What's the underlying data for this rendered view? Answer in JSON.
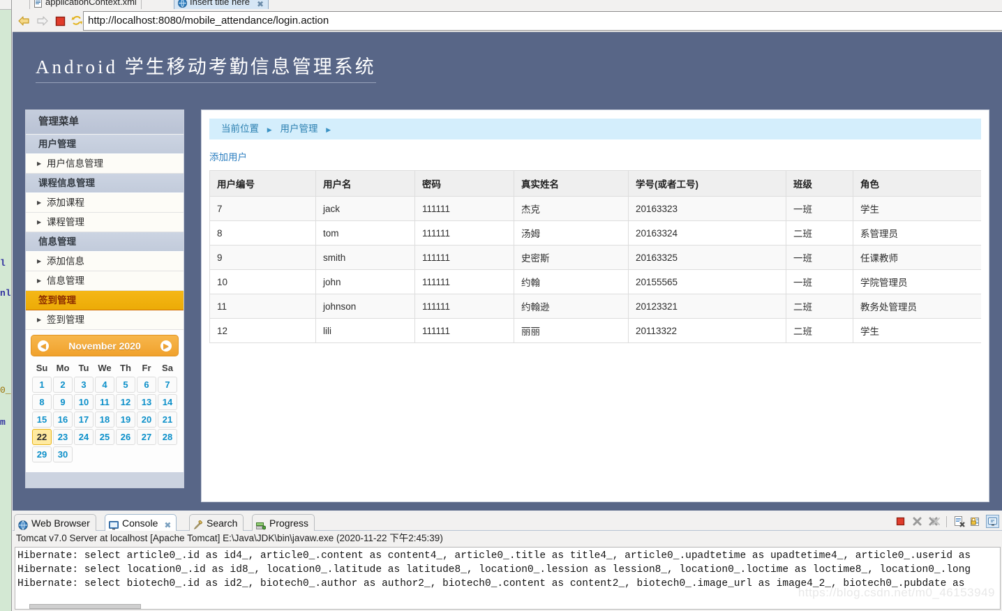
{
  "eclipse": {
    "tabs": [
      {
        "label": "applicationContext.xml",
        "icon": "xml-file-icon",
        "active": false
      },
      {
        "label": "Insert title here",
        "icon": "globe-icon",
        "active": true,
        "close": "✖"
      }
    ],
    "toolbar": {
      "back": "back-arrow",
      "forward": "forward-arrow",
      "stop": "stop-square",
      "refresh": "refresh-arrows"
    },
    "url": "http://localhost:8080/mobile_attendance/login.action",
    "edge_fragments": [
      "l",
      "nl",
      "0_",
      "m"
    ]
  },
  "app": {
    "title_en": "Android",
    "title_cn": "学生移动考勤信息管理系统"
  },
  "sidebar": {
    "menu_title": "管理菜单",
    "sections": [
      {
        "type": "group",
        "label": "用户管理",
        "highlight": false
      },
      {
        "type": "item",
        "label": "用户信息管理"
      },
      {
        "type": "group",
        "label": "课程信息管理",
        "highlight": false
      },
      {
        "type": "item",
        "label": "添加课程"
      },
      {
        "type": "item",
        "label": "课程管理"
      },
      {
        "type": "group",
        "label": "信息管理",
        "highlight": false
      },
      {
        "type": "item",
        "label": "添加信息"
      },
      {
        "type": "item",
        "label": "信息管理"
      },
      {
        "type": "group",
        "label": "签到管理",
        "highlight": true
      },
      {
        "type": "item",
        "label": "签到管理"
      }
    ]
  },
  "calendar": {
    "month_label": "November 2020",
    "prev_icon": "chevron-left-icon",
    "next_icon": "chevron-right-icon",
    "weekdays": [
      "Su",
      "Mo",
      "Tu",
      "We",
      "Th",
      "Fr",
      "Sa"
    ],
    "lead_blanks": 0,
    "days": [
      1,
      2,
      3,
      4,
      5,
      6,
      7,
      8,
      9,
      10,
      11,
      12,
      13,
      14,
      15,
      16,
      17,
      18,
      19,
      20,
      21,
      22,
      23,
      24,
      25,
      26,
      27,
      28,
      29,
      30
    ],
    "today": 22,
    "accent_color": "#f0a12c",
    "day_color": "#0b8fc9",
    "today_bg": "#ffeaa0"
  },
  "content": {
    "breadcrumb": {
      "current": "当前位置",
      "section": "用户管理",
      "sep": "▶"
    },
    "add_link": "添加用户",
    "table": {
      "columns": [
        "用户编号",
        "用户名",
        "密码",
        "真实姓名",
        "学号(或者工号)",
        "班级",
        "角色"
      ],
      "rows": [
        [
          "7",
          "jack",
          "111111",
          "杰克",
          "20163323",
          "一班",
          "学生"
        ],
        [
          "8",
          "tom",
          "111111",
          "汤姆",
          "20163324",
          "二班",
          "系管理员"
        ],
        [
          "9",
          "smith",
          "111111",
          "史密斯",
          "20163325",
          "一班",
          "任课教师"
        ],
        [
          "10",
          "john",
          "111111",
          "约翰",
          "20155565",
          "一班",
          "学院管理员"
        ],
        [
          "11",
          "johnson",
          "111111",
          "约翰逊",
          "20123321",
          "二班",
          "教务处管理员"
        ],
        [
          "12",
          "lili",
          "111111",
          "丽丽",
          "20113322",
          "二班",
          "学生"
        ]
      ]
    }
  },
  "bottom": {
    "tabs": [
      {
        "label": "Web Browser",
        "icon": "globe-icon",
        "selected": false
      },
      {
        "label": "Console",
        "icon": "console-icon",
        "selected": true,
        "close": "✖"
      },
      {
        "label": "Search",
        "icon": "search-icon",
        "selected": false
      },
      {
        "label": "Progress",
        "icon": "progress-icon",
        "selected": false
      }
    ],
    "toolbar_icons": [
      "terminate-icon",
      "remove-launch-icon",
      "remove-all-terminated-icon",
      "clear-console-icon",
      "scroll-lock-icon",
      "pin-console-icon"
    ],
    "console_header": "Tomcat v7.0 Server at localhost [Apache Tomcat] E:\\Java\\JDK\\bin\\javaw.exe (2020-11-22 下午2:45:39)",
    "console_lines": [
      "Hibernate: select article0_.id as id4_, article0_.content as content4_, article0_.title as title4_, article0_.upadtetime as upadtetime4_, article0_.userid as",
      "Hibernate: select location0_.id as id8_, location0_.latitude as latitude8_, location0_.lession as lession8_, location0_.loctime as loctime8_, location0_.long",
      "Hibernate: select biotech0_.id as id2_, biotech0_.author as author2_, biotech0_.content as content2_, biotech0_.image_url as image4_2_, biotech0_.pubdate as"
    ]
  },
  "watermark": "https://blog.csdn.net/m0_46153949",
  "colors": {
    "header_bg": "#586687",
    "menu_highlight": "#f0ae0b",
    "breadcrumb_bg": "#d4eefc",
    "link": "#2d7fc0"
  }
}
